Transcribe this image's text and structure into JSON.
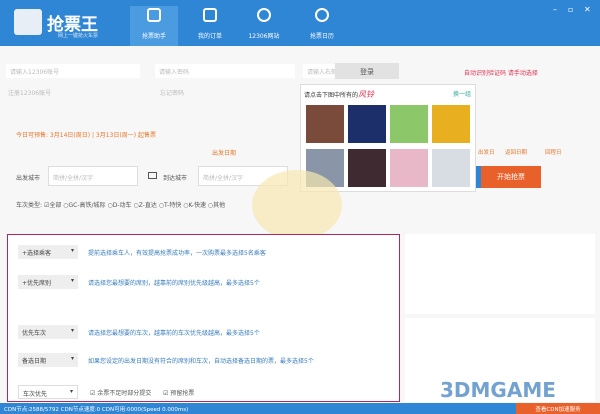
{
  "app": {
    "title": "抢票王",
    "subtitle": "网上一键抢火车票"
  },
  "tabs": [
    {
      "label": "抢票助手"
    },
    {
      "label": "我的订单"
    },
    {
      "label": "12306网站"
    },
    {
      "label": "抢票日历"
    }
  ],
  "login": {
    "account_placeholder": "请输入12306账号",
    "password_placeholder": "请输入密码",
    "captcha_placeholder": "请输入右侧验证码",
    "login_button": "登录",
    "auto_hint": "自动识别验证码 请手动选择",
    "register": "注册12306账号",
    "forgot": "忘记密码"
  },
  "captcha": {
    "prompt": "请点击下图中所有的",
    "target": "风铃",
    "refresh": "换一组"
  },
  "notice": "今日可预售: 3月14日(周日) | 3月13日(周一) 起售票",
  "dates": {
    "depart_label": "出发日期",
    "return_label": "返回日期",
    "right_a": "出发日",
    "right_b": "回程日"
  },
  "search": {
    "from_label": "出发城市",
    "from_placeholder": "简拼/全拼/汉字",
    "to_label": "到达城市",
    "to_placeholder": "简拼/全拼/汉字",
    "start_button": "开始抢票"
  },
  "train_types": {
    "label": "车次类型:",
    "options": [
      "全部",
      "GC-高铁/城际",
      "D-动车",
      "Z-直达",
      "T-特快",
      "K-快速",
      "其他"
    ]
  },
  "rows": [
    {
      "select": "+选择乘客",
      "desc": "提前选择乘车人，有效提高抢票成功率，一次购票最多选择5名乘客"
    },
    {
      "select": "+优先席别",
      "desc": "请选择您最想要的席别，越靠前的席别优先级越高，最多选择5个"
    },
    {
      "select": "优先车次",
      "desc": "请选择您最想要的车次，越靠前的车次优先级越高，最多选择5个"
    },
    {
      "select": "备选日期",
      "desc": "如果您设定的出发日期没有符合的席别和车次，自动选择备选日期的票，最多选择5个"
    }
  ],
  "options": {
    "priority": "车次优先",
    "check1": "余票不足时部分提交",
    "check2": "预留抢票"
  },
  "status": {
    "text": "CDN节点:2588/5792  CDN节点速度:0  CDN可用:0000(Speed 0.000ms)",
    "cdn_button": "查看CDN加速服务"
  },
  "watermark": "3DMGAME"
}
